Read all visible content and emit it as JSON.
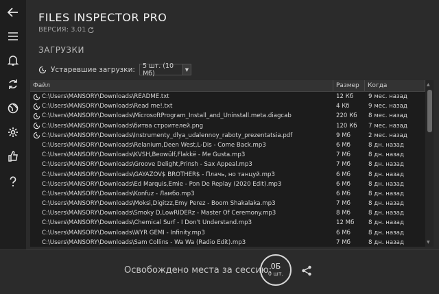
{
  "app": {
    "title": "FILES INSPECTOR PRO",
    "version": "ВЕРСИЯ: 3.01",
    "section_title": "ЗАГРУЗКИ"
  },
  "sidebar": {
    "icons": [
      "back-arrow-icon",
      "menu-icon",
      "bell-icon",
      "refresh-icon",
      "globe-icon",
      "gear-icon",
      "thumbs-up-icon",
      "help-icon"
    ]
  },
  "filter": {
    "label": "Устаревшие загрузки:",
    "selected": "5 шт. (10 Мб)"
  },
  "table": {
    "columns": [
      "Файл",
      "Размер",
      "Когда"
    ],
    "rows": [
      {
        "path": "C:\\Users\\MANSORY\\Downloads\\README.txt",
        "size": "12 Кб",
        "when": "9 мес. назад",
        "outdated": true
      },
      {
        "path": "C:\\Users\\MANSORY\\Downloads\\Read me!.txt",
        "size": "4 Кб",
        "when": "9 мес. назад",
        "outdated": true
      },
      {
        "path": "C:\\Users\\MANSORY\\Downloads\\MicrosoftProgram_Install_and_Uninstall.meta.diagcab",
        "size": "220 Кб",
        "when": "8 мес. назад",
        "outdated": true
      },
      {
        "path": "C:\\Users\\MANSORY\\Downloads\\битва строителей.png",
        "size": "120 Кб",
        "when": "7 мес. назад",
        "outdated": true
      },
      {
        "path": "C:\\Users\\MANSORY\\Downloads\\Instrumenty_dlya_udalennoy_raboty_prezentatsia.pdf",
        "size": "9 Мб",
        "when": "2 мес. назад",
        "outdated": true
      },
      {
        "path": "C:\\Users\\MANSORY\\Downloads\\Relanium,Deen West,L-Dis - Come Back.mp3",
        "size": "6 Мб",
        "when": "8 дн. назад",
        "outdated": false
      },
      {
        "path": "C:\\Users\\MANSORY\\Downloads\\KVSH,Beowülf,Flakkë - Me Gusta.mp3",
        "size": "7 Мб",
        "when": "8 дн. назад",
        "outdated": false
      },
      {
        "path": "C:\\Users\\MANSORY\\Downloads\\Groove Delight,Prinsh - Sax Appeal.mp3",
        "size": "7 Мб",
        "when": "8 дн. назад",
        "outdated": false
      },
      {
        "path": "C:\\Users\\MANSORY\\Downloads\\GAYAZOV$ BROTHER$ - Плачь, но танцуй.mp3",
        "size": "6 Мб",
        "when": "8 дн. назад",
        "outdated": false
      },
      {
        "path": "C:\\Users\\MANSORY\\Downloads\\Ed Marquis,Emie - Pon De Replay (2020 Edit).mp3",
        "size": "6 Мб",
        "when": "8 дн. назад",
        "outdated": false
      },
      {
        "path": "C:\\Users\\MANSORY\\Downloads\\Konfuz - Ламбо.mp3",
        "size": "6 Мб",
        "when": "8 дн. назад",
        "outdated": false
      },
      {
        "path": "C:\\Users\\MANSORY\\Downloads\\Moksi,Digitzz,Emy Perez - Boom Shakalaka.mp3",
        "size": "7 Мб",
        "when": "8 дн. назад",
        "outdated": false
      },
      {
        "path": "C:\\Users\\MANSORY\\Downloads\\Smoky D,LowRIDERz - Master Of Ceremony.mp3",
        "size": "8 Мб",
        "when": "8 дн. назад",
        "outdated": false
      },
      {
        "path": "C:\\Users\\MANSORY\\Downloads\\Chemical Surf - I Don't Understand.mp3",
        "size": "12 Мб",
        "when": "8 дн. назад",
        "outdated": false
      },
      {
        "path": "C:\\Users\\MANSORY\\Downloads\\WYR GEMI - Infinity.mp3",
        "size": "6 Мб",
        "when": "8 дн. назад",
        "outdated": false
      },
      {
        "path": "C:\\Users\\MANSORY\\Downloads\\Sam Collins - Wa Wa (Radio Edit).mp3",
        "size": "7 Мб",
        "when": "8 дн. назад",
        "outdated": false
      }
    ]
  },
  "footer": {
    "freed_label": "Освобождено места за сессию:",
    "freed_value": "0Б",
    "freed_count": "0 шт."
  }
}
